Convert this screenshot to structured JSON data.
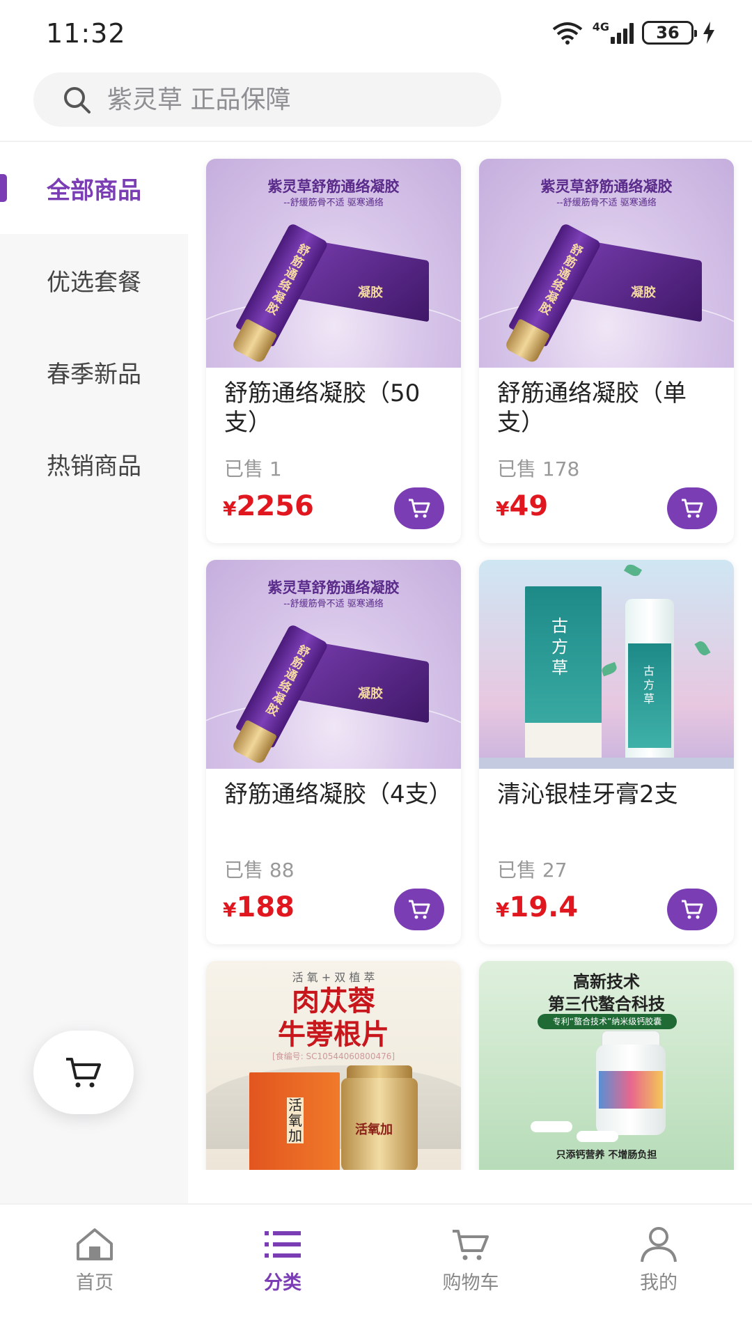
{
  "status_bar": {
    "time": "11:32",
    "network": "4G",
    "battery": "36"
  },
  "search": {
    "placeholder": "紫灵草 正品保障"
  },
  "sidebar": {
    "items": [
      {
        "label": "全部商品",
        "active": true
      },
      {
        "label": "优选套餐",
        "active": false
      },
      {
        "label": "春季新品",
        "active": false
      },
      {
        "label": "热销商品",
        "active": false
      }
    ]
  },
  "images": {
    "gel_title": "紫灵草舒筋通络凝胶",
    "gel_subtitle": "--舒缓筋骨不适 驱寒通络",
    "gel_tube_text": "舒筋通络凝胶",
    "gel_box_text": "凝胶",
    "toothpaste_box_text": "古方草",
    "toothpaste_bottle_text": "古方草",
    "herb_top": "活 氧 + 双 植 萃",
    "herb_title_1": "肉苁蓉",
    "herb_title_2": "牛蒡根片",
    "herb_code": "[食编号: SC10544060800476]",
    "herb_box_text": "活氧加",
    "herb_jar_text": "活氧加",
    "green_line1": "高新技术",
    "green_line2": "第三代螯合科技",
    "green_badge": "专利“螯合技术”纳米级钙胶囊",
    "green_footer": "只添钙营养    不增肠负担"
  },
  "products": [
    {
      "title": "舒筋通络凝胶（50支）",
      "sold": "已售 1",
      "currency": "¥",
      "price": "2256"
    },
    {
      "title": "舒筋通络凝胶（单支）",
      "sold": "已售 178",
      "currency": "¥",
      "price": "49"
    },
    {
      "title": "舒筋通络凝胶（4支）",
      "sold": "已售 88",
      "currency": "¥",
      "price": "188"
    },
    {
      "title": "清沁银桂牙膏2支",
      "sold": "已售 27",
      "currency": "¥",
      "price": "19.4"
    }
  ],
  "tabbar": {
    "items": [
      {
        "label": "首页",
        "icon": "home-icon",
        "active": false
      },
      {
        "label": "分类",
        "icon": "list-icon",
        "active": true
      },
      {
        "label": "购物车",
        "icon": "cart-icon",
        "active": false
      },
      {
        "label": "我的",
        "icon": "user-icon",
        "active": false
      }
    ]
  },
  "colors": {
    "accent": "#7a3db4",
    "price": "#e0171f"
  }
}
